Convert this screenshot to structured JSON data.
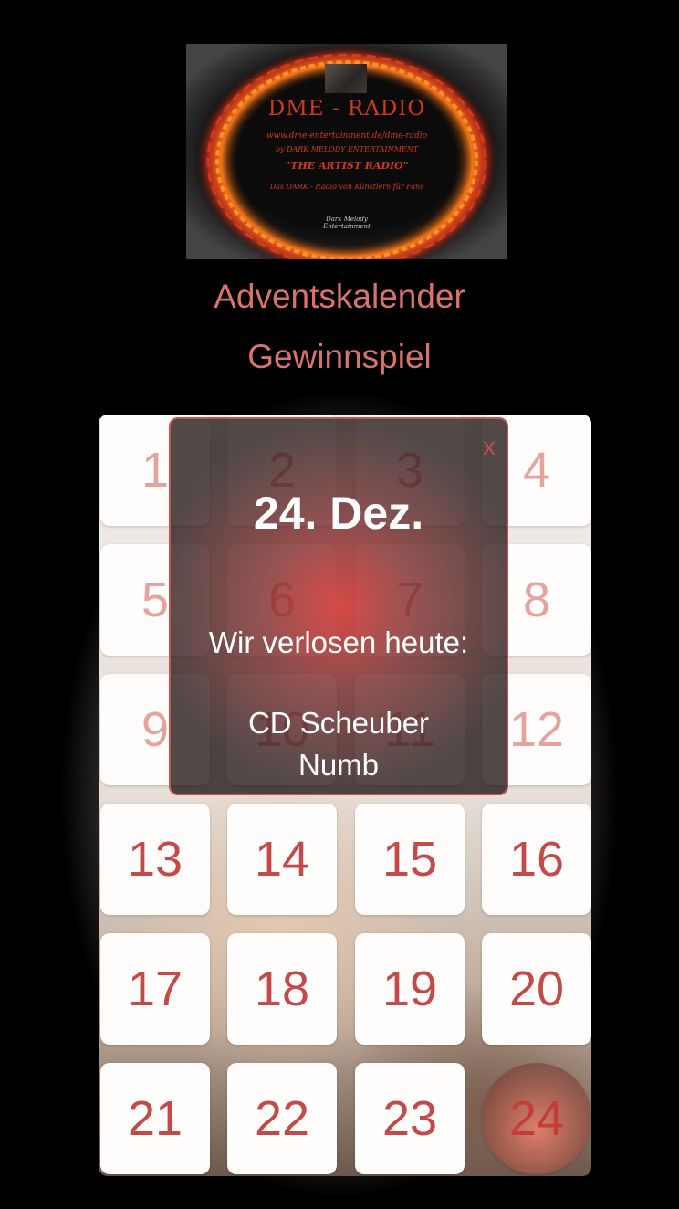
{
  "logo": {
    "title": "DME - RADIO",
    "url": "www.dme-entertainment.de/dme-radio",
    "by": "by DARK MELODY ENTERTAINMENT",
    "tagline": "\"THE ARTIST RADIO\"",
    "subline": "Das DARK - Radio von Künstlern für Fans",
    "signature_line1": "Dark Melody",
    "signature_line2": "Entertainment"
  },
  "heading": {
    "line1": "Adventskalender",
    "line2": "Gewinnspiel"
  },
  "doors": [
    {
      "n": "1"
    },
    {
      "n": "2"
    },
    {
      "n": "3"
    },
    {
      "n": "4"
    },
    {
      "n": "5"
    },
    {
      "n": "6"
    },
    {
      "n": "7"
    },
    {
      "n": "8"
    },
    {
      "n": "9"
    },
    {
      "n": "10"
    },
    {
      "n": "11"
    },
    {
      "n": "12"
    },
    {
      "n": "13"
    },
    {
      "n": "14"
    },
    {
      "n": "15"
    },
    {
      "n": "16"
    },
    {
      "n": "17"
    },
    {
      "n": "18"
    },
    {
      "n": "19"
    },
    {
      "n": "20"
    },
    {
      "n": "21"
    },
    {
      "n": "22"
    },
    {
      "n": "23"
    },
    {
      "n": "24"
    }
  ],
  "modal": {
    "close_label": "x",
    "date": "24. Dez.",
    "lead": "Wir verlosen heute:",
    "prize_line1": "CD Scheuber",
    "prize_line2": "Numb"
  },
  "colors": {
    "accent": "#d9716d",
    "door_number": "#c44a4a",
    "modal_border": "#c8524e"
  }
}
